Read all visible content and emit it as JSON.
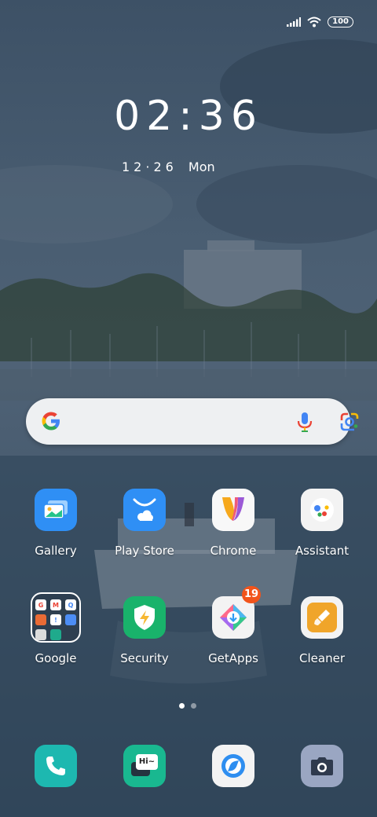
{
  "status": {
    "battery": "100",
    "signal_icon": "signal-bars-icon",
    "wifi_icon": "wifi-icon"
  },
  "lockscreen_clock": {
    "time": "02:36",
    "date": "12·26",
    "weekday": "Mon"
  },
  "search_bar": {
    "google_icon": "google-g-icon",
    "mic_icon": "microphone-icon",
    "lens_icon": "google-lens-icon"
  },
  "apps_row1": [
    {
      "label": "Gallery",
      "icon": "gallery-icon"
    },
    {
      "label": "Play Store",
      "icon": "play-store-icon"
    },
    {
      "label": "Chrome",
      "icon": "chrome-icon"
    },
    {
      "label": "Assistant",
      "icon": "assistant-icon"
    }
  ],
  "apps_row2": [
    {
      "label": "Google",
      "icon": "google-folder-icon"
    },
    {
      "label": "Security",
      "icon": "security-icon"
    },
    {
      "label": "GetApps",
      "icon": "getapps-icon",
      "badge": "19"
    },
    {
      "label": "Cleaner",
      "icon": "cleaner-icon"
    }
  ],
  "folder_minis": [
    "G",
    "M",
    "Q",
    "",
    "!",
    "",
    "",
    "",
    ""
  ],
  "dock": [
    {
      "icon": "phone-icon"
    },
    {
      "icon": "messaging-icon",
      "text": "Hi~"
    },
    {
      "icon": "browser-icon"
    },
    {
      "icon": "camera-icon"
    }
  ],
  "page_indicator": {
    "pages": 2,
    "current": 1
  },
  "colors": {
    "gallery": "#2f8ff5",
    "playstore": "#2f8ff5",
    "security": "#19b36b",
    "cleaner": "#f0a52a",
    "phone": "#1db8b0",
    "messaging": "#19b890",
    "camera": "#9aa6c2",
    "badge": "#f2541b"
  }
}
